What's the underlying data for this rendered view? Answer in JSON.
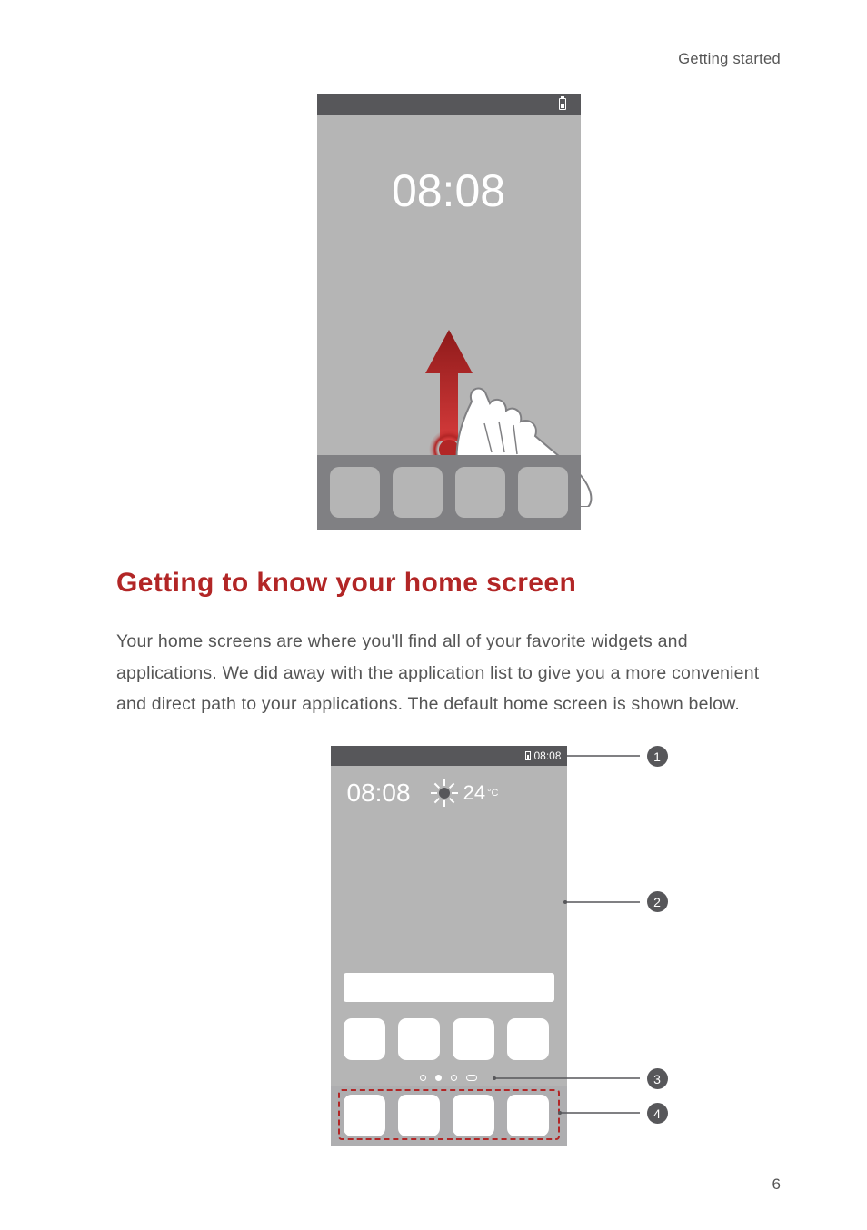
{
  "header": {
    "section_label": "Getting started"
  },
  "figure1": {
    "clock_time": "08:08"
  },
  "heading": "Getting to know your home screen",
  "paragraph": "Your home screens are where you'll find all of your favorite widgets and applications. We did away with the application list to give you a more convenient and direct path to your applications. The default home screen is shown below.",
  "figure2": {
    "status_time": "08:08",
    "widget_clock": "08:08",
    "temperature_value": "24",
    "temperature_unit": "°C",
    "callouts": {
      "c1": "1",
      "c2": "2",
      "c3": "3",
      "c4": "4"
    }
  },
  "page_number": "6"
}
